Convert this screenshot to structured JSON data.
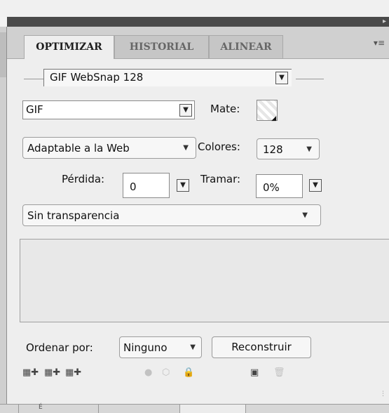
{
  "tabs": [
    "OPTIMIZAR",
    "HISTORIAL",
    "ALINEAR"
  ],
  "preset": {
    "value": "GIF WebSnap 128"
  },
  "format": {
    "value": "GIF"
  },
  "mate": {
    "label": "Mate:"
  },
  "palette": {
    "value": "Adaptable a la Web"
  },
  "colors": {
    "label": "Colores:",
    "value": "128"
  },
  "loss": {
    "label": "Pérdida:",
    "value": "0"
  },
  "dither": {
    "label": "Tramar:",
    "value": "0%"
  },
  "transparency": {
    "value": "Sin transparencia"
  },
  "sort": {
    "label": "Ordenar por:",
    "value": "Ninguno"
  },
  "rebuild_label": "Reconstruir",
  "bottom_tab_glyph": "É"
}
